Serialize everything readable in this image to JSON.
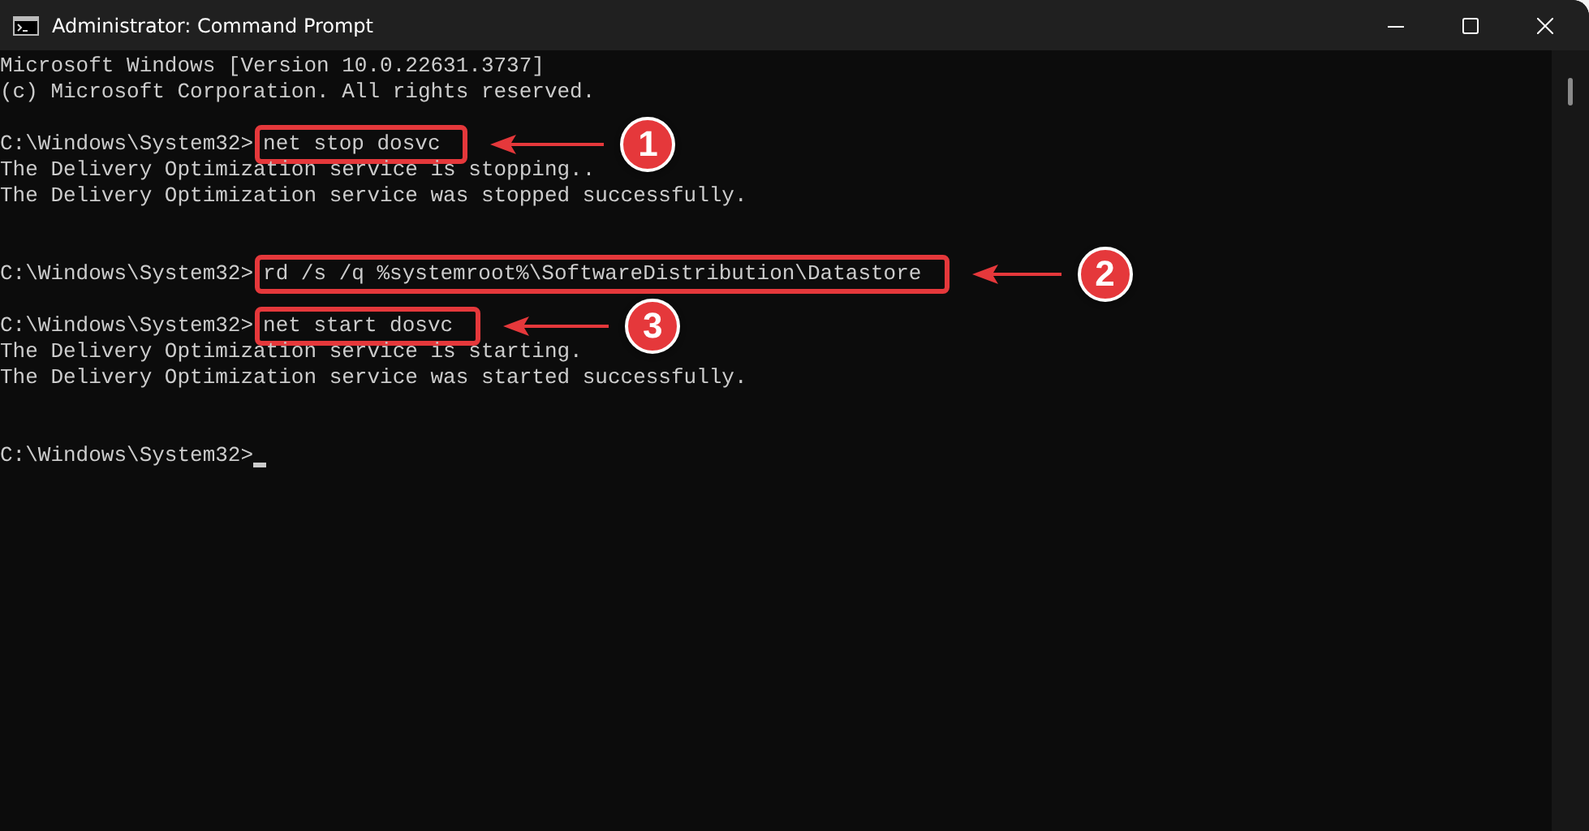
{
  "window": {
    "title": "Administrator: Command Prompt"
  },
  "console_lines": [
    {
      "kind": "output",
      "text": "Microsoft Windows [Version 10.0.22631.3737]"
    },
    {
      "kind": "output",
      "text": "(c) Microsoft Corporation. All rights reserved."
    },
    {
      "kind": "blank"
    },
    {
      "kind": "command",
      "prompt": "C:\\Windows\\System32>",
      "command": "net stop dosvc",
      "marker": "1"
    },
    {
      "kind": "output",
      "text": "The Delivery Optimization service is stopping.."
    },
    {
      "kind": "output",
      "text": "The Delivery Optimization service was stopped successfully."
    },
    {
      "kind": "blank"
    },
    {
      "kind": "blank"
    },
    {
      "kind": "command",
      "prompt": "C:\\Windows\\System32>",
      "command": "rd /s /q %systemroot%\\SoftwareDistribution\\Datastore",
      "marker": "2"
    },
    {
      "kind": "blank"
    },
    {
      "kind": "command",
      "prompt": "C:\\Windows\\System32>",
      "command": "net start dosvc",
      "marker": "3"
    },
    {
      "kind": "output",
      "text": "The Delivery Optimization service is starting."
    },
    {
      "kind": "output",
      "text": "The Delivery Optimization service was started successfully."
    },
    {
      "kind": "blank"
    },
    {
      "kind": "blank"
    },
    {
      "kind": "prompt",
      "prompt": "C:\\Windows\\System32>"
    }
  ]
}
